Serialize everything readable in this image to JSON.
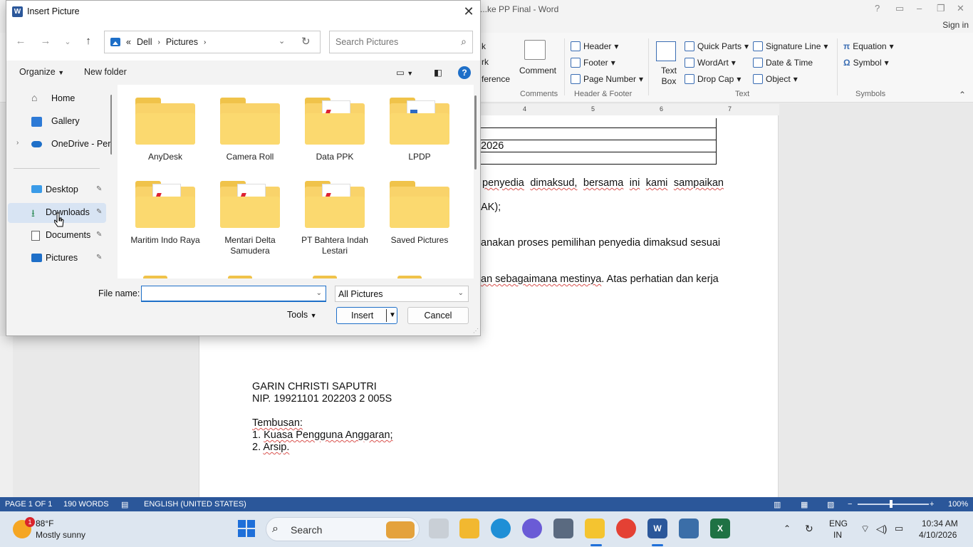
{
  "word": {
    "doc_title": "...ke PP Final - Word",
    "signin": "Sign in",
    "ribbon": {
      "partial_left": [
        "k",
        "rk",
        "ference"
      ],
      "comment": "Comment",
      "header": "Header",
      "footer": "Footer",
      "page_number": "Page Number",
      "text_box": "Text Box",
      "quick_parts": "Quick Parts",
      "wordart": "WordArt",
      "drop_cap": "Drop Cap",
      "signature_line": "Signature Line",
      "date_time": "Date & Time",
      "object": "Object",
      "equation": "Equation",
      "symbol": "Symbol",
      "groups": {
        "comments": "Comments",
        "header_footer": "Header & Footer",
        "text": "Text",
        "symbols": "Symbols"
      }
    },
    "ruler": [
      "4",
      "5",
      "6",
      "7"
    ],
    "doc": {
      "table_year": "2026",
      "line1_words": [
        "penyedia",
        "dimaksud,",
        "bersama",
        "ini",
        "kami",
        "sampaikan"
      ],
      "line2": "AK);",
      "line3": "anakan proses pemilihan penyedia dimaksud sesuai",
      "line4_a": "an sebagaimana mestinya",
      "line4_b": ". Atas perhatian dan kerja",
      "signer_name": "GARIN CHRISTI SAPUTRI",
      "signer_nip": "NIP.  19921101 202203 2 005S",
      "cc_title": "Tembusan:",
      "cc1_num": "1.",
      "cc1": "Kuasa Pengguna Anggaran;",
      "cc2_num": "2.",
      "cc2": "Arsip."
    },
    "status": {
      "page": "PAGE 1 OF 1",
      "words": "190 WORDS",
      "language": "ENGLISH (UNITED STATES)",
      "zoom": "100%"
    }
  },
  "dialog": {
    "title": "Insert Picture",
    "breadcrumb": [
      "Dell",
      "Pictures"
    ],
    "breadcrumb_prefix": "«",
    "search_placeholder": "Search Pictures",
    "organize": "Organize",
    "new_folder": "New folder",
    "nav_items": [
      {
        "label": "Home",
        "icon": "home-icon"
      },
      {
        "label": "Gallery",
        "icon": "gallery-icon"
      },
      {
        "label": "OneDrive - Perso",
        "icon": "onedrive-icon"
      },
      {
        "label": "Desktop",
        "icon": "desktop-icon"
      },
      {
        "label": "Downloads",
        "icon": "download-icon"
      },
      {
        "label": "Documents",
        "icon": "documents-icon"
      },
      {
        "label": "Pictures",
        "icon": "pictures-icon"
      }
    ],
    "folders": [
      {
        "name": "AnyDesk",
        "doc": false
      },
      {
        "name": "Camera Roll",
        "doc": false
      },
      {
        "name": "Data PPK",
        "doc": true
      },
      {
        "name": "LPDP",
        "doc": true
      },
      {
        "name": "Maritim Indo Raya",
        "doc": true
      },
      {
        "name": "Mentari Delta Samudera",
        "doc": true
      },
      {
        "name": "PT Bahtera Indah Lestari",
        "doc": true
      },
      {
        "name": "Saved Pictures",
        "doc": false
      }
    ],
    "file_name_label": "File name:",
    "file_name_value": "",
    "file_type": "All Pictures",
    "tools": "Tools",
    "insert": "Insert",
    "cancel": "Cancel"
  },
  "taskbar": {
    "weather_temp": "88°F",
    "weather_cond": "Mostly sunny",
    "weather_badge": "1",
    "search": "Search",
    "lang1": "ENG",
    "lang2": "IN",
    "time": "10:34 AM",
    "date": "4/10/2026"
  },
  "colors": {
    "word_blue": "#2b579a",
    "accent": "#1e6fc8",
    "folder": "#f9d36a"
  }
}
